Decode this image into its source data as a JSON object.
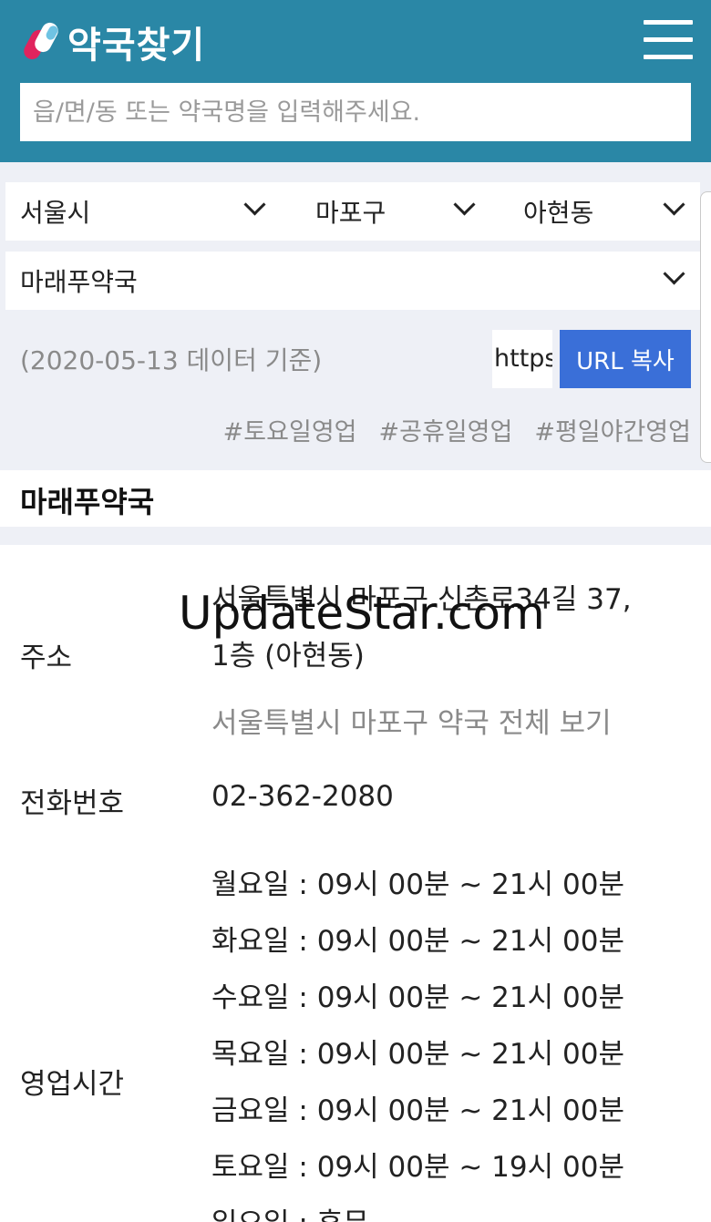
{
  "header": {
    "logo_text": "약국찾기",
    "search_placeholder": "읍/면/동 또는 약국명을 입력해주세요."
  },
  "filters": {
    "city": "서울시",
    "district": "마포구",
    "dong": "아현동",
    "pharmacy": "마래푸약국"
  },
  "data_note": "(2020-05-13 데이터 기준)",
  "url_value": "https",
  "url_button": "URL 복사",
  "tags": [
    "#토요일영업",
    "#공휴일영업",
    "#평일야간영업"
  ],
  "pharmacy": {
    "name": "마래푸약국",
    "address_label": "주소",
    "address_line1": "서울특별시 마포구 신촌로34길 37,",
    "address_line2": "1층 (아현동)",
    "view_all": "서울특별시 마포구 약국 전체 보기",
    "phone_label": "전화번호",
    "phone": "02-362-2080",
    "hours_label": "영업시간",
    "hours": [
      "월요일 : 09시 00분 ~ 21시 00분",
      "화요일 : 09시 00분 ~ 21시 00분",
      "수요일 : 09시 00분 ~ 21시 00분",
      "목요일 : 09시 00분 ~ 21시 00분",
      "금요일 : 09시 00분 ~ 21시 00분",
      "토요일 : 09시 00분 ~ 19시 00분",
      "일요일 : 휴무"
    ]
  },
  "watermark": "UpdateStar.com",
  "colors": {
    "header_bg": "#2a87a6",
    "button_bg": "#3a6fd8",
    "strip_bg": "#eef0f6"
  }
}
